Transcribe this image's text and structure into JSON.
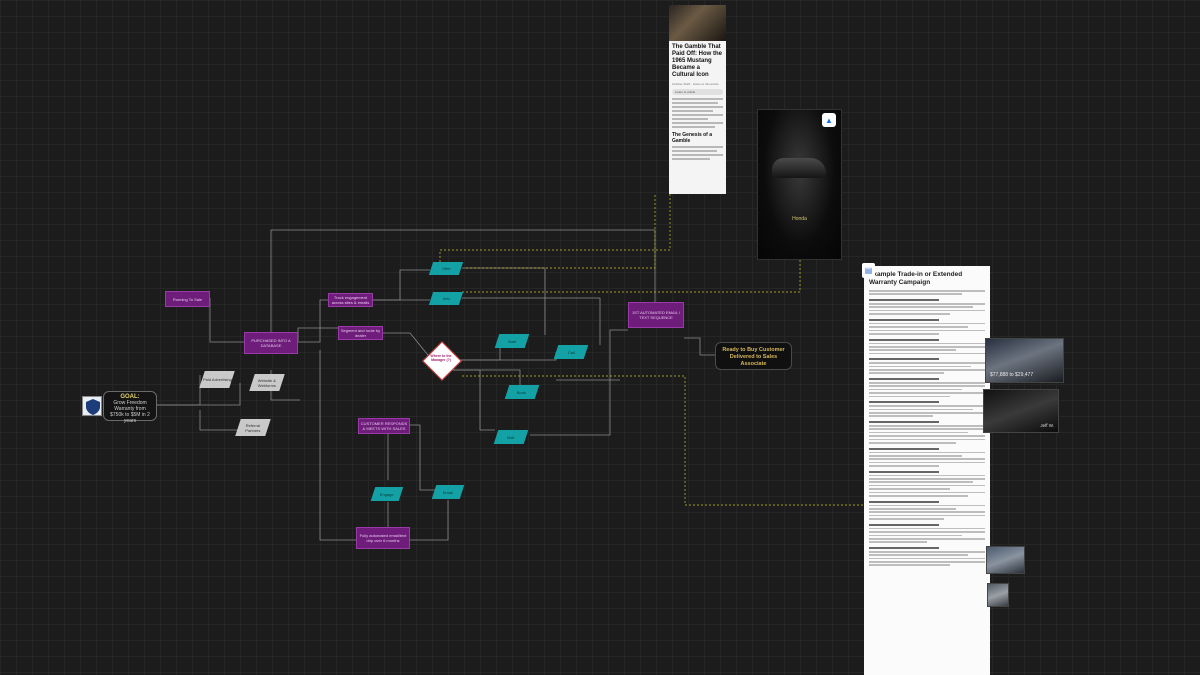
{
  "goal": {
    "title": "GOAL:",
    "text": "Grow Freedom Warranty from $750k to $5M in 2 years"
  },
  "ready": {
    "text": "Ready to Buy Customer Delivered to Sales Associate"
  },
  "diamond": {
    "label": "Where to the Manager (?)"
  },
  "purple_boxes": [
    {
      "id": "p1",
      "text": "Running To Sale"
    },
    {
      "id": "p2",
      "text": "PURCHASED INTO A DATABASE"
    },
    {
      "id": "p3",
      "text": "Track engagement across sites & emails"
    },
    {
      "id": "p4",
      "text": "Segment and route by dealer"
    },
    {
      "id": "p5",
      "text": "1ST AUTOMATED EMAIL / TEXT SEQUENCE"
    },
    {
      "id": "p6",
      "text": "CUSTOMER RESPONDS & MEETS WITH SALES"
    },
    {
      "id": "p7",
      "text": "Fully automated email/text drip over 6 months"
    }
  ],
  "teal_boxes": [
    "Offer",
    "Info",
    "Start",
    "Call",
    "Book",
    "Visit",
    "Engage",
    "Email",
    "Text",
    "Reply"
  ],
  "grey_boxes": [
    "Paid Advertising",
    "Website & Webforms",
    "Referral Partners"
  ],
  "article": {
    "title": "The Gamble That Paid Off: How the 1965 Mustang Became a Cultural Icon",
    "meta": "October 2024 · Listen to this article",
    "player": "Listen to article",
    "section": "The Genesis of a Gamble"
  },
  "promo": {
    "brand": "Honda"
  },
  "doc": {
    "title": "Example Trade-in or Extended Warranty Campaign"
  },
  "thumb_labels": [
    "$77,888 to $29,477",
    "Jeff W."
  ],
  "colors": {
    "purple": "#6e1d7a",
    "teal": "#14a1a5",
    "connector": "#8a8a8a",
    "dashed": "#c9c62a"
  }
}
